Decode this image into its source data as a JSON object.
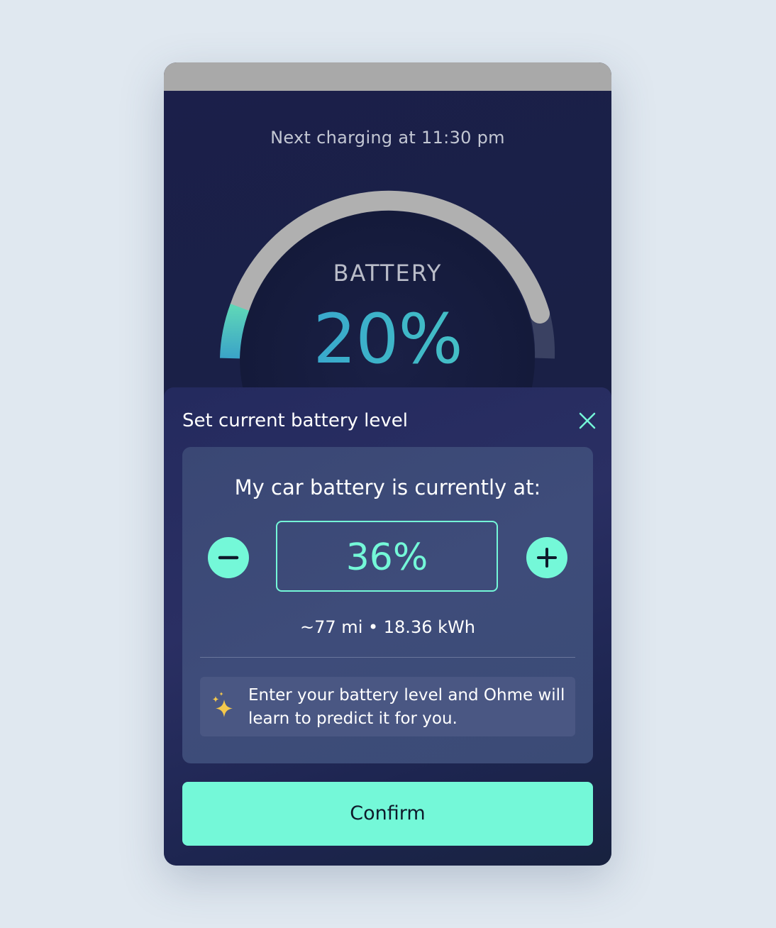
{
  "colors": {
    "accent": "#74f8d8",
    "background_dark": "#1b1f4a",
    "status_bar": "#a9a9a9",
    "gauge_track": "#b0b0b0",
    "gauge_fill_start": "#2f8fd4",
    "gauge_fill_end": "#56d3c2",
    "page_background": "#e0e8f0"
  },
  "header": {
    "next_charging": "Next charging at 11:30 pm"
  },
  "gauge": {
    "label": "BATTERY",
    "value_text": "20%",
    "level": 0.2
  },
  "sheet": {
    "title": "Set current battery level",
    "close_icon": "close-icon",
    "heading": "My car battery is currently at:",
    "value": "36%",
    "decrement_icon": "minus-icon",
    "increment_icon": "plus-icon",
    "range": "~77 mi • 18.36 kWh",
    "tip_icon": "sparkle-icon",
    "tip": "Enter your battery level and Ohme will learn to predict it for you.",
    "confirm_label": "Confirm"
  }
}
